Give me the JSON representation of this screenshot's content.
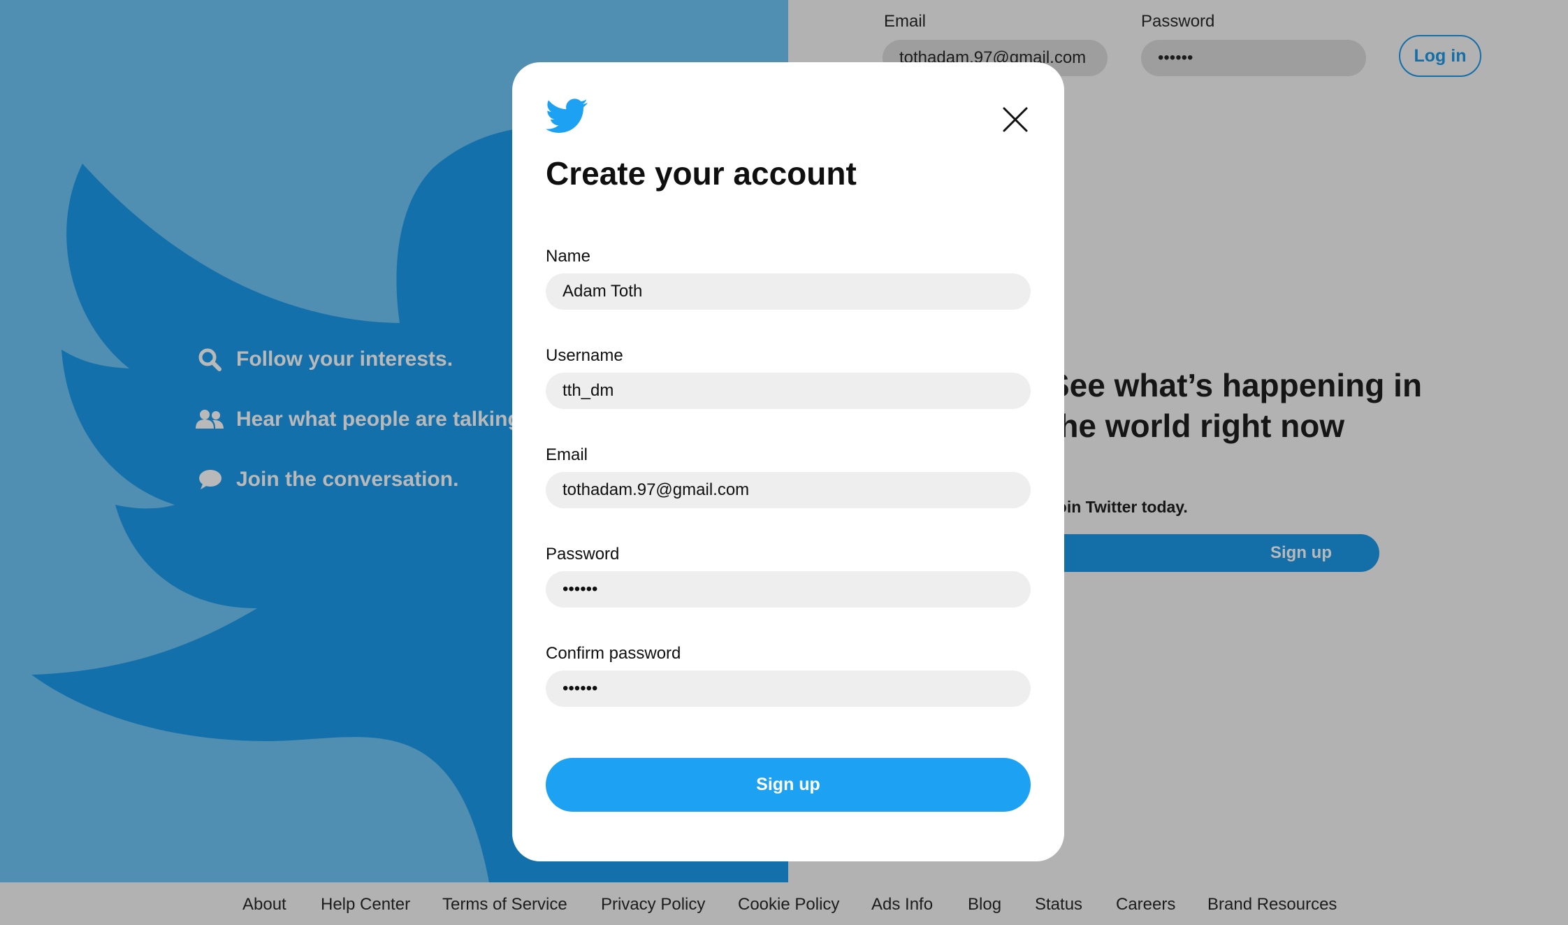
{
  "background": {
    "features": [
      {
        "icon": "search-icon",
        "label": "Follow your interests."
      },
      {
        "icon": "people-icon",
        "label": "Hear what people are talking about."
      },
      {
        "icon": "chat-bubble-icon",
        "label": "Join the conversation."
      }
    ],
    "login": {
      "email_label": "Email",
      "email_value": "tothadam.97@gmail.com",
      "password_label": "Password",
      "password_value": "••••••",
      "login_button": "Log in"
    },
    "headline_line1": "See what’s happening in",
    "headline_line2": "the world right now",
    "subtext": "Join Twitter today.",
    "signup_button": "Sign up"
  },
  "modal": {
    "title": "Create your account",
    "fields": {
      "name": {
        "label": "Name",
        "value": "Adam Toth"
      },
      "username": {
        "label": "Username",
        "value": "tth_dm"
      },
      "email": {
        "label": "Email",
        "value": "tothadam.97@gmail.com"
      },
      "password": {
        "label": "Password",
        "value": "••••••"
      },
      "confirm_password": {
        "label": "Confirm password",
        "value": "••••••"
      }
    },
    "submit_label": "Sign up"
  },
  "footer": {
    "links": [
      "About",
      "Help Center",
      "Terms of Service",
      "Privacy Policy",
      "Cookie Policy",
      "Ads Info",
      "Blog",
      "Status",
      "Careers",
      "Brand Resources"
    ]
  },
  "colors": {
    "twitter_blue": "#1da1f2",
    "dimmed_blue": "#146ea8",
    "dimmed_panel": "#518fb2",
    "overlay_gray": "#b2b2b2"
  }
}
